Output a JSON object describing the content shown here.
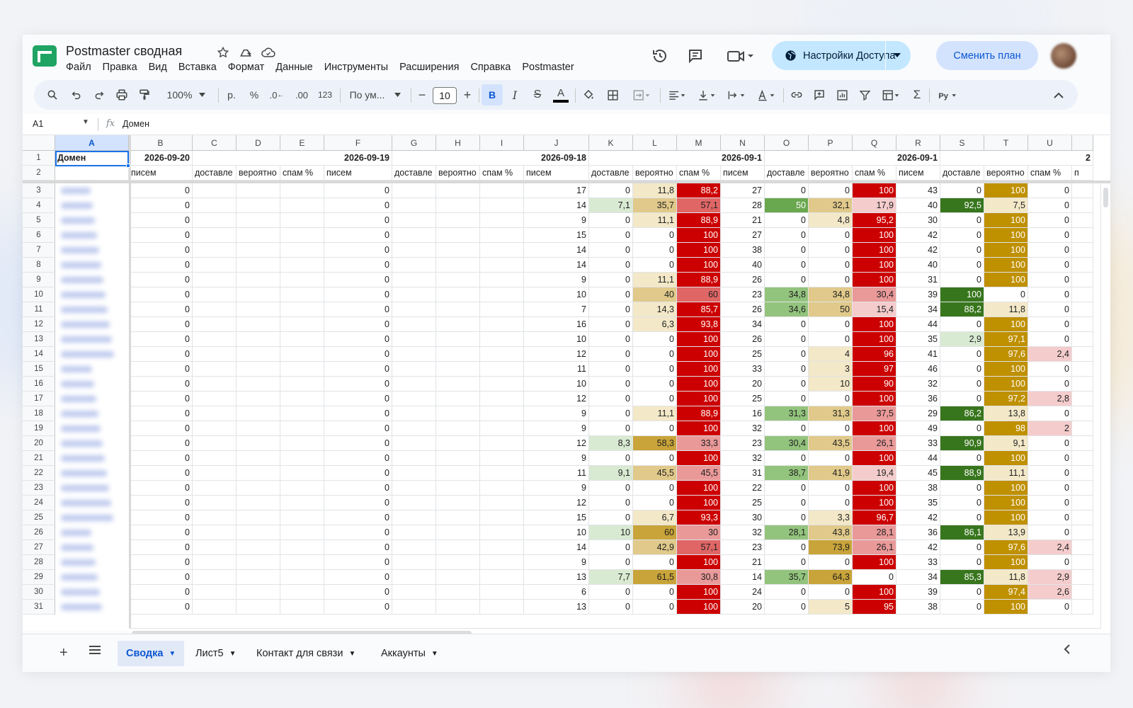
{
  "doc": {
    "title": "Postmaster сводная",
    "menu": [
      "Файл",
      "Правка",
      "Вид",
      "Вставка",
      "Формат",
      "Данные",
      "Инструменты",
      "Расширения",
      "Справка",
      "Postmaster"
    ],
    "share_label": "Настройки Доступа",
    "plan_label": "Сменить план"
  },
  "toolbar": {
    "zoom": "100%",
    "currency": "р.",
    "percent": "%",
    "dec_less": ".0",
    "dec_more": ".00",
    "number_format": "123",
    "font": "По ум...",
    "font_size": "10",
    "bold": "B",
    "italic": "I",
    "strike": "S",
    "text_color": "A"
  },
  "formula": {
    "cell_ref": "A1",
    "fx": "fx",
    "content": "Домен"
  },
  "grid": {
    "columns": [
      "A",
      "B",
      "C",
      "D",
      "E",
      "F",
      "G",
      "H",
      "I",
      "J",
      "K",
      "L",
      "M",
      "N",
      "O",
      "P",
      "Q",
      "R",
      "S",
      "T",
      "U"
    ],
    "row1": {
      "A": "Домен",
      "B": "2026-09-20",
      "F": "2026-09-19",
      "J": "2026-09-18",
      "N": "2026-09-1",
      "R": "2026-09-1",
      "V": "2"
    },
    "row2": {
      "B": "писем",
      "C": "доставле",
      "D": "вероятно",
      "E": "спам %",
      "F": "писем",
      "G": "доставле",
      "H": "вероятно",
      "I": "спам %",
      "J": "писем",
      "K": "доставле",
      "L": "вероятно",
      "M": "спам %",
      "N": "писем",
      "O": "доставле",
      "P": "вероятно",
      "Q": "спам %",
      "R": "писем",
      "S": "доставле",
      "T": "вероятно",
      "U": "спам %",
      "V": "п"
    },
    "rows": [
      {
        "n": "3",
        "B": "0",
        "F": "0",
        "J": "17",
        "K": "0",
        "L": "11,8",
        "M": "88,2",
        "N": "27",
        "O": "0",
        "P": "0",
        "Q": "100",
        "R": "43",
        "S": "0",
        "T": "100",
        "U": "0"
      },
      {
        "n": "4",
        "B": "0",
        "F": "0",
        "J": "14",
        "K": "7,1",
        "L": "35,7",
        "M": "57,1",
        "N": "28",
        "O": "50",
        "P": "32,1",
        "Q": "17,9",
        "R": "40",
        "S": "92,5",
        "T": "7,5",
        "U": "0"
      },
      {
        "n": "5",
        "B": "0",
        "F": "0",
        "J": "9",
        "K": "0",
        "L": "11,1",
        "M": "88,9",
        "N": "21",
        "O": "0",
        "P": "4,8",
        "Q": "95,2",
        "R": "30",
        "S": "0",
        "T": "100",
        "U": "0"
      },
      {
        "n": "6",
        "B": "0",
        "F": "0",
        "J": "15",
        "K": "0",
        "L": "0",
        "M": "100",
        "N": "27",
        "O": "0",
        "P": "0",
        "Q": "100",
        "R": "42",
        "S": "0",
        "T": "100",
        "U": "0"
      },
      {
        "n": "7",
        "B": "0",
        "F": "0",
        "J": "14",
        "K": "0",
        "L": "0",
        "M": "100",
        "N": "38",
        "O": "0",
        "P": "0",
        "Q": "100",
        "R": "42",
        "S": "0",
        "T": "100",
        "U": "0"
      },
      {
        "n": "8",
        "B": "0",
        "F": "0",
        "J": "14",
        "K": "0",
        "L": "0",
        "M": "100",
        "N": "40",
        "O": "0",
        "P": "0",
        "Q": "100",
        "R": "40",
        "S": "0",
        "T": "100",
        "U": "0"
      },
      {
        "n": "9",
        "B": "0",
        "F": "0",
        "J": "9",
        "K": "0",
        "L": "11,1",
        "M": "88,9",
        "N": "26",
        "O": "0",
        "P": "0",
        "Q": "100",
        "R": "31",
        "S": "0",
        "T": "100",
        "U": "0"
      },
      {
        "n": "10",
        "B": "0",
        "F": "0",
        "J": "10",
        "K": "0",
        "L": "40",
        "M": "60",
        "N": "23",
        "O": "34,8",
        "P": "34,8",
        "Q": "30,4",
        "R": "39",
        "S": "100",
        "T": "0",
        "U": "0"
      },
      {
        "n": "11",
        "B": "0",
        "F": "0",
        "J": "7",
        "K": "0",
        "L": "14,3",
        "M": "85,7",
        "N": "26",
        "O": "34,6",
        "P": "50",
        "Q": "15,4",
        "R": "34",
        "S": "88,2",
        "T": "11,8",
        "U": "0"
      },
      {
        "n": "12",
        "B": "0",
        "F": "0",
        "J": "16",
        "K": "0",
        "L": "6,3",
        "M": "93,8",
        "N": "34",
        "O": "0",
        "P": "0",
        "Q": "100",
        "R": "44",
        "S": "0",
        "T": "100",
        "U": "0"
      },
      {
        "n": "13",
        "B": "0",
        "F": "0",
        "J": "10",
        "K": "0",
        "L": "0",
        "M": "100",
        "N": "26",
        "O": "0",
        "P": "0",
        "Q": "100",
        "R": "35",
        "S": "2,9",
        "T": "97,1",
        "U": "0"
      },
      {
        "n": "14",
        "B": "0",
        "F": "0",
        "J": "12",
        "K": "0",
        "L": "0",
        "M": "100",
        "N": "25",
        "O": "0",
        "P": "4",
        "Q": "96",
        "R": "41",
        "S": "0",
        "T": "97,6",
        "U": "2,4"
      },
      {
        "n": "15",
        "B": "0",
        "F": "0",
        "J": "11",
        "K": "0",
        "L": "0",
        "M": "100",
        "N": "33",
        "O": "0",
        "P": "3",
        "Q": "97",
        "R": "46",
        "S": "0",
        "T": "100",
        "U": "0"
      },
      {
        "n": "16",
        "B": "0",
        "F": "0",
        "J": "10",
        "K": "0",
        "L": "0",
        "M": "100",
        "N": "20",
        "O": "0",
        "P": "10",
        "Q": "90",
        "R": "32",
        "S": "0",
        "T": "100",
        "U": "0"
      },
      {
        "n": "17",
        "B": "0",
        "F": "0",
        "J": "12",
        "K": "0",
        "L": "0",
        "M": "100",
        "N": "25",
        "O": "0",
        "P": "0",
        "Q": "100",
        "R": "36",
        "S": "0",
        "T": "97,2",
        "U": "2,8"
      },
      {
        "n": "18",
        "B": "0",
        "F": "0",
        "J": "9",
        "K": "0",
        "L": "11,1",
        "M": "88,9",
        "N": "16",
        "O": "31,3",
        "P": "31,3",
        "Q": "37,5",
        "R": "29",
        "S": "86,2",
        "T": "13,8",
        "U": "0"
      },
      {
        "n": "19",
        "B": "0",
        "F": "0",
        "J": "9",
        "K": "0",
        "L": "0",
        "M": "100",
        "N": "32",
        "O": "0",
        "P": "0",
        "Q": "100",
        "R": "49",
        "S": "0",
        "T": "98",
        "U": "2"
      },
      {
        "n": "20",
        "B": "0",
        "F": "0",
        "J": "12",
        "K": "8,3",
        "L": "58,3",
        "M": "33,3",
        "N": "23",
        "O": "30,4",
        "P": "43,5",
        "Q": "26,1",
        "R": "33",
        "S": "90,9",
        "T": "9,1",
        "U": "0"
      },
      {
        "n": "21",
        "B": "0",
        "F": "0",
        "J": "9",
        "K": "0",
        "L": "0",
        "M": "100",
        "N": "32",
        "O": "0",
        "P": "0",
        "Q": "100",
        "R": "44",
        "S": "0",
        "T": "100",
        "U": "0"
      },
      {
        "n": "22",
        "B": "0",
        "F": "0",
        "J": "11",
        "K": "9,1",
        "L": "45,5",
        "M": "45,5",
        "N": "31",
        "O": "38,7",
        "P": "41,9",
        "Q": "19,4",
        "R": "45",
        "S": "88,9",
        "T": "11,1",
        "U": "0"
      },
      {
        "n": "23",
        "B": "0",
        "F": "0",
        "J": "9",
        "K": "0",
        "L": "0",
        "M": "100",
        "N": "22",
        "O": "0",
        "P": "0",
        "Q": "100",
        "R": "38",
        "S": "0",
        "T": "100",
        "U": "0"
      },
      {
        "n": "24",
        "B": "0",
        "F": "0",
        "J": "12",
        "K": "0",
        "L": "0",
        "M": "100",
        "N": "25",
        "O": "0",
        "P": "0",
        "Q": "100",
        "R": "35",
        "S": "0",
        "T": "100",
        "U": "0"
      },
      {
        "n": "25",
        "B": "0",
        "F": "0",
        "J": "15",
        "K": "0",
        "L": "6,7",
        "M": "93,3",
        "N": "30",
        "O": "0",
        "P": "3,3",
        "Q": "96,7",
        "R": "42",
        "S": "0",
        "T": "100",
        "U": "0"
      },
      {
        "n": "26",
        "B": "0",
        "F": "0",
        "J": "10",
        "K": "10",
        "L": "60",
        "M": "30",
        "N": "32",
        "O": "28,1",
        "P": "43,8",
        "Q": "28,1",
        "R": "36",
        "S": "86,1",
        "T": "13,9",
        "U": "0"
      },
      {
        "n": "27",
        "B": "0",
        "F": "0",
        "J": "14",
        "K": "0",
        "L": "42,9",
        "M": "57,1",
        "N": "23",
        "O": "0",
        "P": "73,9",
        "Q": "26,1",
        "R": "42",
        "S": "0",
        "T": "97,6",
        "U": "2,4"
      },
      {
        "n": "28",
        "B": "0",
        "F": "0",
        "J": "9",
        "K": "0",
        "L": "0",
        "M": "100",
        "N": "21",
        "O": "0",
        "P": "0",
        "Q": "100",
        "R": "33",
        "S": "0",
        "T": "100",
        "U": "0"
      },
      {
        "n": "29",
        "B": "0",
        "F": "0",
        "J": "13",
        "K": "7,7",
        "L": "61,5",
        "M": "30,8",
        "N": "14",
        "O": "35,7",
        "P": "64,3",
        "Q": "0",
        "R": "34",
        "S": "85,3",
        "T": "11,8",
        "U": "2,9"
      },
      {
        "n": "30",
        "B": "0",
        "F": "0",
        "J": "6",
        "K": "0",
        "L": "0",
        "M": "100",
        "N": "24",
        "O": "0",
        "P": "0",
        "Q": "100",
        "R": "39",
        "S": "0",
        "T": "97,4",
        "U": "2,6"
      },
      {
        "n": "31",
        "B": "0",
        "F": "0",
        "J": "13",
        "K": "0",
        "L": "0",
        "M": "100",
        "N": "20",
        "O": "0",
        "P": "5",
        "Q": "95",
        "R": "38",
        "S": "0",
        "T": "100",
        "U": "0"
      }
    ]
  },
  "sheets": [
    {
      "label": "Сводка",
      "active": true
    },
    {
      "label": "Лист5",
      "active": false
    },
    {
      "label": "Контакт для связи",
      "active": false
    },
    {
      "label": "Аккаунты",
      "active": false
    }
  ],
  "colors": {
    "accent": "#0b57d0",
    "spam_red": "#cc0000",
    "delivered_green": "#38761d",
    "probable_gold": "#bf9000"
  }
}
